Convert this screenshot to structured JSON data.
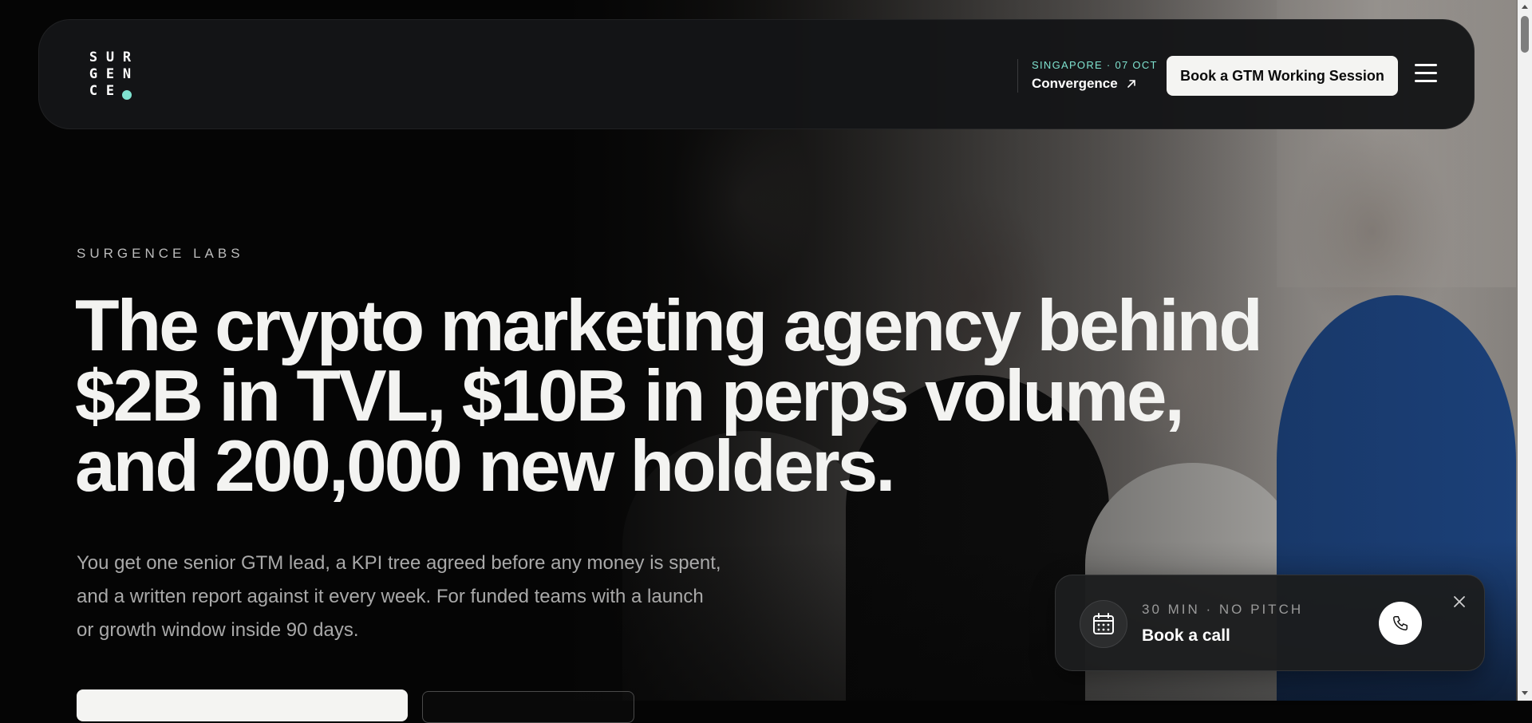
{
  "header": {
    "logo_letters": [
      "S",
      "U",
      "R",
      "G",
      "E",
      "N",
      "C",
      "E",
      ""
    ],
    "event_meta": "SINGAPORE · 07 OCT",
    "event_name": "Convergence",
    "cta_label": "Book a GTM Working Session"
  },
  "hero": {
    "eyebrow": "SURGENCE LABS",
    "headline_lines": [
      "The crypto marketing agency behind",
      "$2B in TVL, $10B in perps volume,",
      "and 200,000 new holders."
    ],
    "subcopy_lines": [
      "You get one senior GTM lead, a KPI tree agreed before any money is spent,",
      "and a written report against it every week. For funded teams with a launch",
      "or growth window inside 90 days."
    ]
  },
  "call_popup": {
    "meta": "30 MIN · NO PITCH",
    "title": "Book a call"
  },
  "colors": {
    "accent": "#7fe3d0",
    "background": "#050505",
    "button_light": "#f4f4f2"
  }
}
